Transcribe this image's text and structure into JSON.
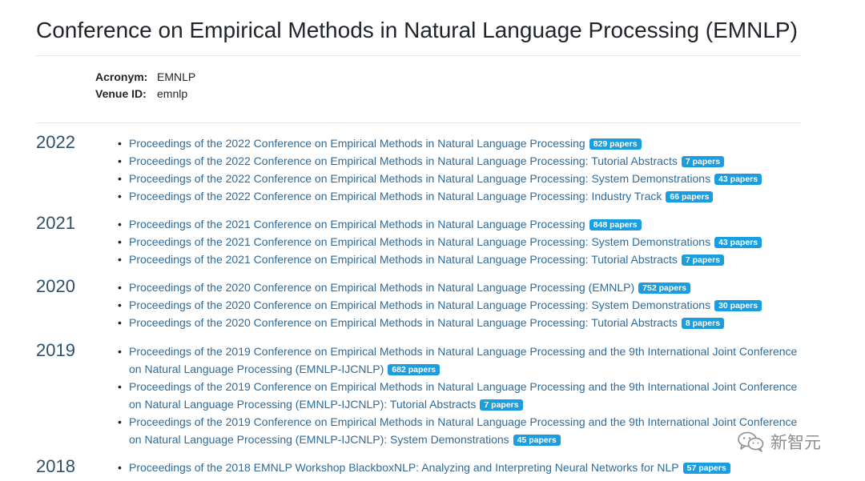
{
  "venue": {
    "title": "Conference on Empirical Methods in Natural Language Processing (EMNLP)",
    "acronym_label": "Acronym:",
    "acronym": "EMNLP",
    "venue_id_label": "Venue ID:",
    "venue_id": "emnlp"
  },
  "years": [
    {
      "year": "2022",
      "pubs": [
        {
          "title": "Proceedings of the 2022 Conference on Empirical Methods in Natural Language Processing",
          "badge": "829 papers"
        },
        {
          "title": "Proceedings of the 2022 Conference on Empirical Methods in Natural Language Processing: Tutorial Abstracts",
          "badge": "7 papers"
        },
        {
          "title": "Proceedings of the 2022 Conference on Empirical Methods in Natural Language Processing: System Demonstrations",
          "badge": "43 papers"
        },
        {
          "title": "Proceedings of the 2022 Conference on Empirical Methods in Natural Language Processing: Industry Track",
          "badge": "66 papers"
        }
      ]
    },
    {
      "year": "2021",
      "pubs": [
        {
          "title": "Proceedings of the 2021 Conference on Empirical Methods in Natural Language Processing",
          "badge": "848 papers"
        },
        {
          "title": "Proceedings of the 2021 Conference on Empirical Methods in Natural Language Processing: System Demonstrations",
          "badge": "43 papers"
        },
        {
          "title": "Proceedings of the 2021 Conference on Empirical Methods in Natural Language Processing: Tutorial Abstracts",
          "badge": "7 papers"
        }
      ]
    },
    {
      "year": "2020",
      "pubs": [
        {
          "title": "Proceedings of the 2020 Conference on Empirical Methods in Natural Language Processing (EMNLP)",
          "badge": "752 papers"
        },
        {
          "title": "Proceedings of the 2020 Conference on Empirical Methods in Natural Language Processing: System Demonstrations",
          "badge": "30 papers"
        },
        {
          "title": "Proceedings of the 2020 Conference on Empirical Methods in Natural Language Processing: Tutorial Abstracts",
          "badge": "8 papers"
        }
      ]
    },
    {
      "year": "2019",
      "pubs": [
        {
          "title": "Proceedings of the 2019 Conference on Empirical Methods in Natural Language Processing and the 9th International Joint Conference on Natural Language Processing (EMNLP-IJCNLP)",
          "badge": "682 papers"
        },
        {
          "title": "Proceedings of the 2019 Conference on Empirical Methods in Natural Language Processing and the 9th International Joint Conference on Natural Language Processing (EMNLP-IJCNLP): Tutorial Abstracts",
          "badge": "7 papers"
        },
        {
          "title": "Proceedings of the 2019 Conference on Empirical Methods in Natural Language Processing and the 9th International Joint Conference on Natural Language Processing (EMNLP-IJCNLP): System Demonstrations",
          "badge": "45 papers"
        }
      ]
    },
    {
      "year": "2018",
      "pubs": [
        {
          "title": "Proceedings of the 2018 EMNLP Workshop BlackboxNLP: Analyzing and Interpreting Neural Networks for NLP",
          "badge": "57 papers"
        }
      ]
    }
  ],
  "watermark": {
    "text": "新智元",
    "icon": "wechat-icon"
  }
}
